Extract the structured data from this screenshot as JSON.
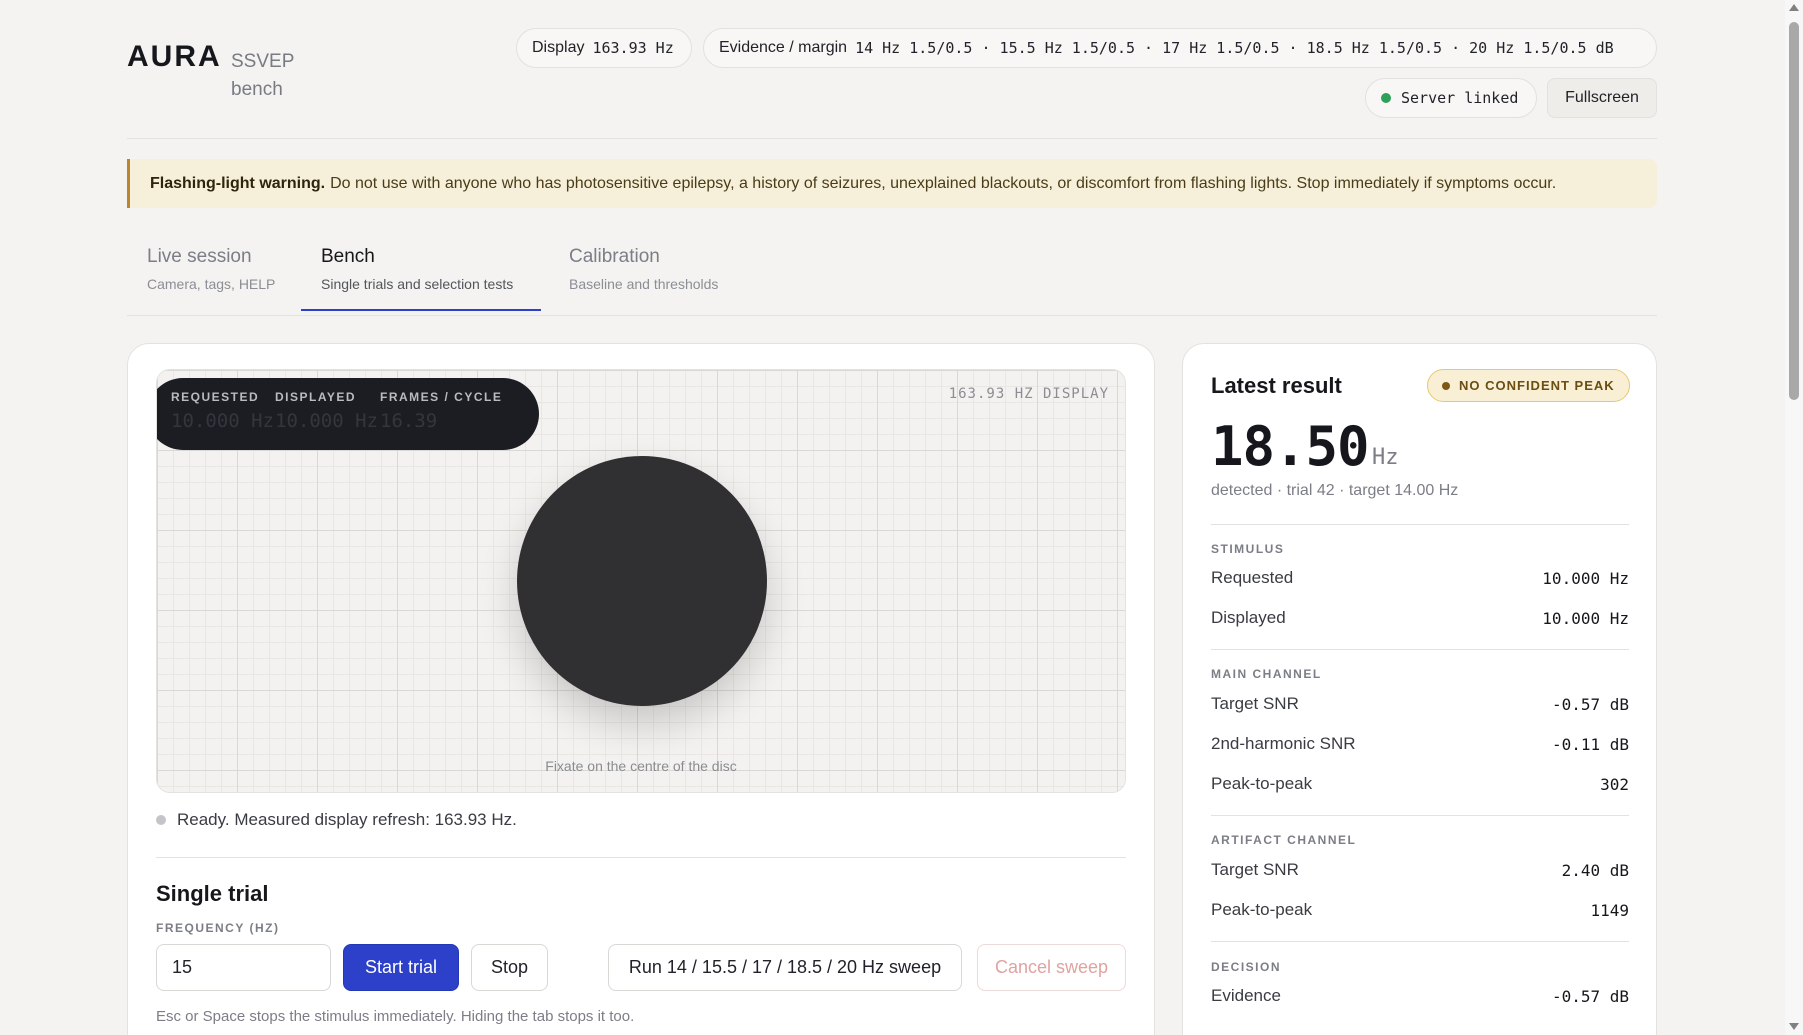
{
  "header": {
    "brand": "AURA",
    "brand_sub": "SSVEP bench",
    "display_label": "Display",
    "display_value": "163.93 Hz",
    "evidence_label": "Evidence / margin",
    "evidence_value": "14 Hz 1.5/0.5 · 15.5 Hz 1.5/0.5 · 17 Hz 1.5/0.5 · 18.5 Hz 1.5/0.5 · 20 Hz 1.5/0.5 dB",
    "server_status": "Server linked",
    "server_status_color": "#2ea05a",
    "fullscreen_label": "Fullscreen"
  },
  "warning": {
    "title": "Flashing-light warning.",
    "text": "Do not use with anyone who has photosensitive epilepsy, a history of seizures, unexplained blackouts, or discomfort from flashing lights. Stop immediately if symptoms occur."
  },
  "tabs": [
    {
      "label": "Live session",
      "sub": "Camera, tags, HELP",
      "active": false
    },
    {
      "label": "Bench",
      "sub": "Single trials and selection tests",
      "active": true
    },
    {
      "label": "Calibration",
      "sub": "Baseline and thresholds",
      "active": false
    }
  ],
  "stage": {
    "readout": [
      {
        "label": "REQUESTED",
        "value": "10.000 Hz"
      },
      {
        "label": "DISPLAYED",
        "value": "10.000 Hz"
      },
      {
        "label": "FRAMES / CYCLE",
        "value": "16.39"
      }
    ],
    "display_tag": "163.93 HZ DISPLAY",
    "fixate_text": "Fixate on the centre of the disc"
  },
  "status": {
    "text": "Ready. Measured display refresh: 163.93 Hz."
  },
  "single_trial": {
    "title": "Single trial",
    "frequency_label": "FREQUENCY (HZ)",
    "frequency_value": "15",
    "start_label": "Start trial",
    "stop_label": "Stop",
    "sweep_label": "Run 14 / 15.5 / 17 / 18.5 / 20 Hz sweep",
    "cancel_label": "Cancel sweep",
    "hint": "Esc or Space stops the stimulus immediately. Hiding the tab stops it too."
  },
  "latest_result": {
    "title": "Latest result",
    "badge": "NO CONFIDENT PEAK",
    "value": "18.50",
    "unit": "Hz",
    "sub": "detected · trial 42 · target 14.00 Hz",
    "sections": {
      "stimulus": {
        "label": "STIMULUS",
        "rows": [
          {
            "k": "Requested",
            "v": "10.000 Hz"
          },
          {
            "k": "Displayed",
            "v": "10.000 Hz"
          }
        ]
      },
      "main": {
        "label": "MAIN CHANNEL",
        "rows": [
          {
            "k": "Target SNR",
            "v": "-0.57 dB"
          },
          {
            "k": "2nd-harmonic SNR",
            "v": "-0.11 dB"
          },
          {
            "k": "Peak-to-peak",
            "v": "302"
          }
        ]
      },
      "artifact": {
        "label": "ARTIFACT CHANNEL",
        "rows": [
          {
            "k": "Target SNR",
            "v": "2.40 dB"
          },
          {
            "k": "Peak-to-peak",
            "v": "1149"
          }
        ]
      },
      "decision": {
        "label": "DECISION",
        "rows": [
          {
            "k": "Evidence",
            "v": "-0.57 dB"
          }
        ]
      }
    }
  },
  "colors": {
    "accent": "#2c40c9",
    "warning_bg": "#f6efd9",
    "badge_bg": "#f8efd5"
  }
}
